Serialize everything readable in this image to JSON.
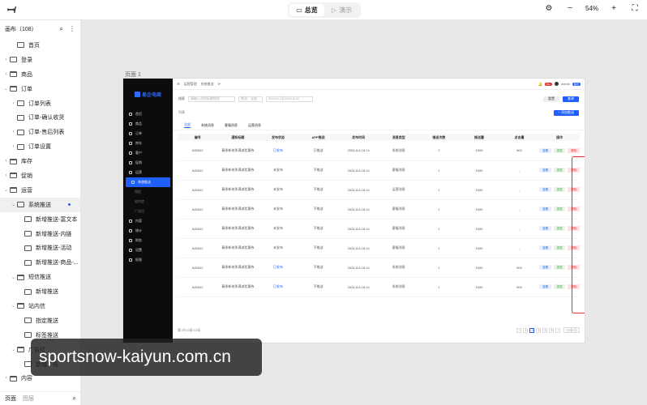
{
  "topbar": {
    "logo": "ꟷ/",
    "mode_overview": "总览",
    "mode_demo": "演示",
    "zoom": "54%",
    "zoom_out": "−",
    "zoom_in": "+",
    "settings_icon": "sliders-icon",
    "fit_icon": "fit-screen-icon"
  },
  "sidebar": {
    "title": "画布（108）",
    "items": [
      {
        "label": "首页",
        "level": 1,
        "type": "page",
        "chevron": ""
      },
      {
        "label": "登录",
        "level": 0,
        "type": "page",
        "chevron": "›"
      },
      {
        "label": "商品",
        "level": 0,
        "type": "folder",
        "chevron": "›"
      },
      {
        "label": "订单",
        "level": 0,
        "type": "folder",
        "chevron": "⌄"
      },
      {
        "label": "订单列表",
        "level": 1,
        "type": "page",
        "chevron": "›"
      },
      {
        "label": "订单-确认收货",
        "level": 1,
        "type": "page",
        "chevron": ""
      },
      {
        "label": "订单-售后列表",
        "level": 1,
        "type": "page",
        "chevron": "›"
      },
      {
        "label": "订单设置",
        "level": 1,
        "type": "page",
        "chevron": "›"
      },
      {
        "label": "库存",
        "level": 0,
        "type": "folder",
        "chevron": "›"
      },
      {
        "label": "促销",
        "level": 0,
        "type": "folder",
        "chevron": "›"
      },
      {
        "label": "运营",
        "level": 0,
        "type": "folder",
        "chevron": "⌄"
      },
      {
        "label": "系统推送",
        "level": 1,
        "type": "page",
        "chevron": "⌄",
        "active": true
      },
      {
        "label": "新增推送-富文本",
        "level": 2,
        "type": "page",
        "chevron": ""
      },
      {
        "label": "新增推送-内链",
        "level": 2,
        "type": "page",
        "chevron": ""
      },
      {
        "label": "新增推送-活动",
        "level": 2,
        "type": "page",
        "chevron": ""
      },
      {
        "label": "新增推送-商品-...",
        "level": 2,
        "type": "page",
        "chevron": ""
      },
      {
        "label": "短信推送",
        "level": 1,
        "type": "folder",
        "chevron": "⌄"
      },
      {
        "label": "新增推送",
        "level": 2,
        "type": "page",
        "chevron": ""
      },
      {
        "label": "站内信",
        "level": 1,
        "type": "folder",
        "chevron": "⌄"
      },
      {
        "label": "指定推送",
        "level": 2,
        "type": "page",
        "chevron": ""
      },
      {
        "label": "标签推送",
        "level": 2,
        "type": "page",
        "chevron": ""
      },
      {
        "label": "广告位",
        "level": 1,
        "type": "folder",
        "chevron": "⌄"
      },
      {
        "label": "新增广告",
        "level": 2,
        "type": "page",
        "chevron": ""
      },
      {
        "label": "内容",
        "level": 0,
        "type": "folder",
        "chevron": "›"
      }
    ],
    "bottom_pages": "页面",
    "bottom_layers": "图层"
  },
  "canvas": {
    "frame_label": "页面 1",
    "app": {
      "brand": "易企电商",
      "menu": [
        {
          "label": "首页",
          "type": "item"
        },
        {
          "label": "商品",
          "type": "item"
        },
        {
          "label": "订单",
          "type": "item"
        },
        {
          "label": "库存",
          "type": "item"
        },
        {
          "label": "客户",
          "type": "item"
        },
        {
          "label": "促销",
          "type": "item"
        },
        {
          "label": "运营",
          "type": "item"
        },
        {
          "label": "系统推送",
          "type": "active"
        },
        {
          "label": "短信",
          "type": "sub"
        },
        {
          "label": "站内信",
          "type": "sub"
        },
        {
          "label": "广告位",
          "type": "sub"
        },
        {
          "label": "内容",
          "type": "item"
        },
        {
          "label": "统计",
          "type": "item"
        },
        {
          "label": "财务",
          "type": "item"
        },
        {
          "label": "设置",
          "type": "item"
        },
        {
          "label": "权限",
          "type": "item"
        }
      ],
      "breadcrumb_a": "运营管理",
      "breadcrumb_b": "系统推送",
      "user": "admin",
      "user_badge": "超管",
      "notif_count": "99+",
      "filter_label": "搜索",
      "filter_placeholder": "请输入消息标题搜索",
      "filter_status": "推送：全部",
      "filter_date": "2024-8-2至2024-8-22",
      "reset": "重置",
      "search": "查询",
      "list_label": "列表",
      "add_push": "+ 添加推送",
      "tabs": [
        "全部",
        "系统消息",
        "客服消息",
        "运营消息"
      ],
      "columns": [
        "编号",
        "通知标题",
        "发布状态",
        "APP推送",
        "发布时间",
        "消息类型",
        "推送次数",
        "推送量",
        "点击量",
        "操作"
      ],
      "rows": [
        [
          "826542",
          "春季新电季满减优惠券",
          "已发布",
          "已推送",
          "2024-8-8 16:14",
          "系统消息",
          "2",
          "1000",
          "500"
        ],
        [
          "826542",
          "春季新电季满减优惠券",
          "未发布",
          "不推送",
          "2024-8-8 16:14",
          "客服消息",
          "1",
          "1000",
          "-"
        ],
        [
          "826542",
          "春季新电季满减优惠券",
          "未发布",
          "不推送",
          "2024-8-8 16:14",
          "运营消息",
          "1",
          "1000",
          "-"
        ],
        [
          "826542",
          "春季新电季满减优惠券",
          "未发布",
          "不推送",
          "2024-8-8 16:14",
          "客服消息",
          "1",
          "1000",
          "-"
        ],
        [
          "826542",
          "春季新电季满减优惠券",
          "未发布",
          "不推送",
          "2024-8-8 16:14",
          "客服消息",
          "1",
          "1000",
          "-"
        ],
        [
          "826542",
          "春季新电季满减优惠券",
          "未发布",
          "不推送",
          "2024-8-8 16:14",
          "客服消息",
          "1",
          "1000",
          "-"
        ],
        [
          "826542",
          "春季新电季满减优惠券",
          "已发布",
          "不推送",
          "2024-8-8 16:14",
          "系统消息",
          "1",
          "1000",
          "500"
        ],
        [
          "826542",
          "春季新电季满减优惠券",
          "已发布",
          "不推送",
          "2024-8-8 16:14",
          "系统消息",
          "1",
          "1000",
          "500"
        ]
      ],
      "action_view": "查看",
      "action_send": "发送",
      "action_delete": "删除",
      "pager_total": "第1共10条/10条",
      "pages": [
        "‹",
        "1",
        "2",
        "3",
        "4",
        "5",
        "›"
      ],
      "page_size": "20条/页"
    }
  },
  "watermark": "sportsnow-kaiyun.com.cn"
}
